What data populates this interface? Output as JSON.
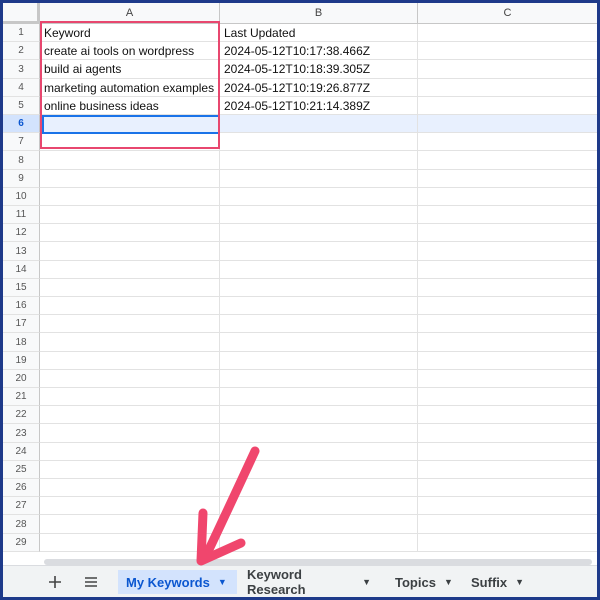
{
  "columns": [
    "A",
    "B",
    "C"
  ],
  "rows": [
    {
      "num": "1",
      "a": "Keyword",
      "b": "Last Updated"
    },
    {
      "num": "2",
      "a": "create ai tools on wordpress",
      "b": "2024-05-12T10:17:38.466Z"
    },
    {
      "num": "3",
      "a": "build ai agents",
      "b": "2024-05-12T10:18:39.305Z"
    },
    {
      "num": "4",
      "a": "marketing automation examples",
      "b": "2024-05-12T10:19:26.877Z"
    },
    {
      "num": "5",
      "a": "online business ideas",
      "b": "2024-05-12T10:21:14.389Z"
    },
    {
      "num": "6",
      "a": "",
      "b": ""
    },
    {
      "num": "7",
      "a": "",
      "b": ""
    },
    {
      "num": "8",
      "a": "",
      "b": ""
    },
    {
      "num": "9",
      "a": "",
      "b": ""
    },
    {
      "num": "10",
      "a": "",
      "b": ""
    },
    {
      "num": "11",
      "a": "",
      "b": ""
    },
    {
      "num": "12",
      "a": "",
      "b": ""
    },
    {
      "num": "13",
      "a": "",
      "b": ""
    },
    {
      "num": "14",
      "a": "",
      "b": ""
    },
    {
      "num": "15",
      "a": "",
      "b": ""
    },
    {
      "num": "16",
      "a": "",
      "b": ""
    },
    {
      "num": "17",
      "a": "",
      "b": ""
    },
    {
      "num": "18",
      "a": "",
      "b": ""
    },
    {
      "num": "19",
      "a": "",
      "b": ""
    },
    {
      "num": "20",
      "a": "",
      "b": ""
    },
    {
      "num": "21",
      "a": "",
      "b": ""
    },
    {
      "num": "22",
      "a": "",
      "b": ""
    },
    {
      "num": "23",
      "a": "",
      "b": ""
    },
    {
      "num": "24",
      "a": "",
      "b": ""
    },
    {
      "num": "25",
      "a": "",
      "b": ""
    },
    {
      "num": "26",
      "a": "",
      "b": ""
    },
    {
      "num": "27",
      "a": "",
      "b": ""
    },
    {
      "num": "28",
      "a": "",
      "b": ""
    },
    {
      "num": "29",
      "a": "",
      "b": ""
    }
  ],
  "selected_row": "6",
  "bottom_bar": {
    "add_icon": "plus-icon",
    "menu_icon": "hamburger-menu-icon",
    "tabs": [
      {
        "label": "My Keywords",
        "active": true
      },
      {
        "label": "Keyword Research",
        "active": false
      },
      {
        "label": "Topics",
        "active": false
      },
      {
        "label": "Suffix",
        "active": false
      }
    ]
  },
  "colors": {
    "frame": "#1e3a8a",
    "highlight": "#e8476f",
    "arrow": "#f0466d",
    "selection": "#1a73e8",
    "active_tab": "#d3e3fd"
  }
}
